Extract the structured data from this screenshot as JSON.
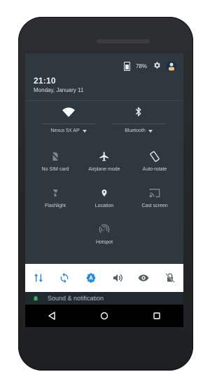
{
  "status_bar": {
    "battery_percent": "78%"
  },
  "header": {
    "time": "21:10",
    "date": "Monday, January 11"
  },
  "quick_settings": {
    "wifi": {
      "label": "Nexus 5X AP",
      "icon": "wifi-icon"
    },
    "bluetooth": {
      "label": "Bluetooth",
      "icon": "bluetooth-icon"
    },
    "tiles": [
      {
        "label": "No SIM card",
        "icon": "no-sim-icon"
      },
      {
        "label": "Airplane mode",
        "icon": "airplane-icon"
      },
      {
        "label": "Auto-rotate",
        "icon": "auto-rotate-icon"
      },
      {
        "label": "Flashlight",
        "icon": "flashlight-icon"
      },
      {
        "label": "Location",
        "icon": "location-icon"
      },
      {
        "label": "Cast screen",
        "icon": "cast-icon"
      },
      {
        "label": "Hotspot",
        "icon": "hotspot-icon"
      }
    ]
  },
  "bottom_toggles": [
    {
      "icon": "data-transfer-icon"
    },
    {
      "icon": "sync-icon"
    },
    {
      "icon": "auto-brightness-icon"
    },
    {
      "icon": "volume-icon"
    },
    {
      "icon": "eye-icon"
    },
    {
      "icon": "lock-rotation-icon"
    }
  ],
  "settings_peek": {
    "label": "Sound & notification"
  },
  "colors": {
    "shade_bg": "#2f383e",
    "accent_blue": "#1e88e5"
  }
}
